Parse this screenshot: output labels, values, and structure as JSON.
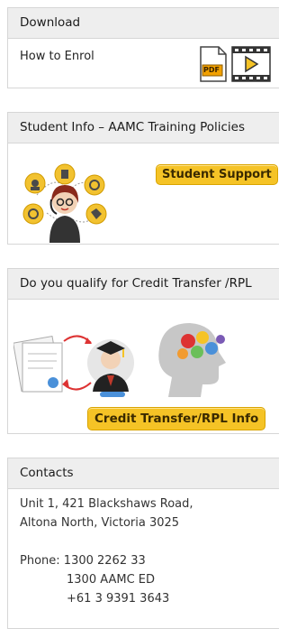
{
  "download": {
    "title": "Download",
    "link": "How to Enrol",
    "pdf_icon_text": "PDF"
  },
  "policies": {
    "title": "Student Info – AAMC Training Policies",
    "button": "Student Support"
  },
  "credit": {
    "title": "Do you qualify for Credit Transfer /RPL",
    "button": "Credit Transfer/RPL Info"
  },
  "contacts": {
    "title": "Contacts",
    "address_line1": "Unit 1, 421 Blackshaws Road,",
    "address_line2": "Altona North, Victoria 3025",
    "phone_label": "Phone:",
    "phone1": "1300 2262 33",
    "phone2": "1300 AAMC ED",
    "phone3": "+61 3 9391 3643"
  },
  "colors": {
    "button_yellow": "#f5c326",
    "header_gray": "#eeeeee",
    "pdf_orange": "#f2a100"
  }
}
